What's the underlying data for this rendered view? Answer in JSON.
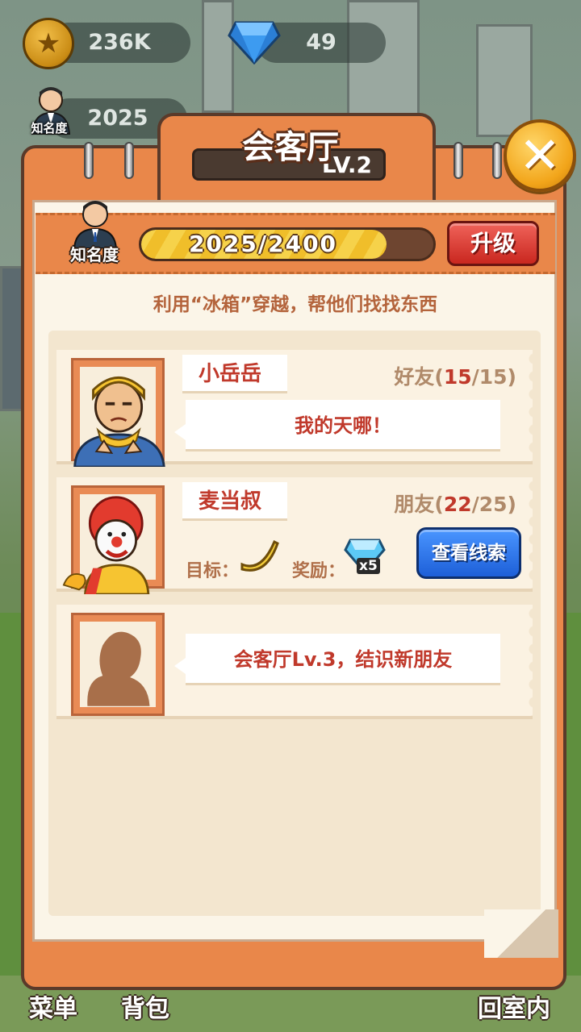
{
  "hud": {
    "coins": "236K",
    "gems": "49",
    "fame_value": "2025",
    "fame_label": "知名度"
  },
  "panel": {
    "title": "会客厅",
    "level": "LV.2",
    "close_icon": "close-icon"
  },
  "fame": {
    "label": "知名度",
    "progress_text": "2025/2400",
    "progress_fraction": 0.84,
    "upgrade_label": "升级"
  },
  "hint": "利用“冰箱”穿越，帮他们找找东西",
  "friends": [
    {
      "name": "小岳岳",
      "relation_prefix": "好友(",
      "relation_current": "15",
      "relation_suffix": "/15)",
      "message": "我的天哪！"
    },
    {
      "name": "麦当叔",
      "relation_prefix": "朋友(",
      "relation_current": "22",
      "relation_suffix": "/25)",
      "goal_label": "目标：",
      "goal_icon": "banana-icon",
      "reward_label": "奖励：",
      "reward_icon": "diamond-icon",
      "reward_count": "x5",
      "clue_button": "查看线索"
    },
    {
      "message": "会客厅Lv.3，结识新朋友"
    }
  ],
  "bottom_nav": {
    "menu": "菜单",
    "bag": "背包",
    "home": "回室内"
  },
  "colors": {
    "panel_orange": "#e9874a",
    "upgrade_red": "#d8342b",
    "clue_blue": "#2a6fe8",
    "text_red": "#c0392b"
  }
}
